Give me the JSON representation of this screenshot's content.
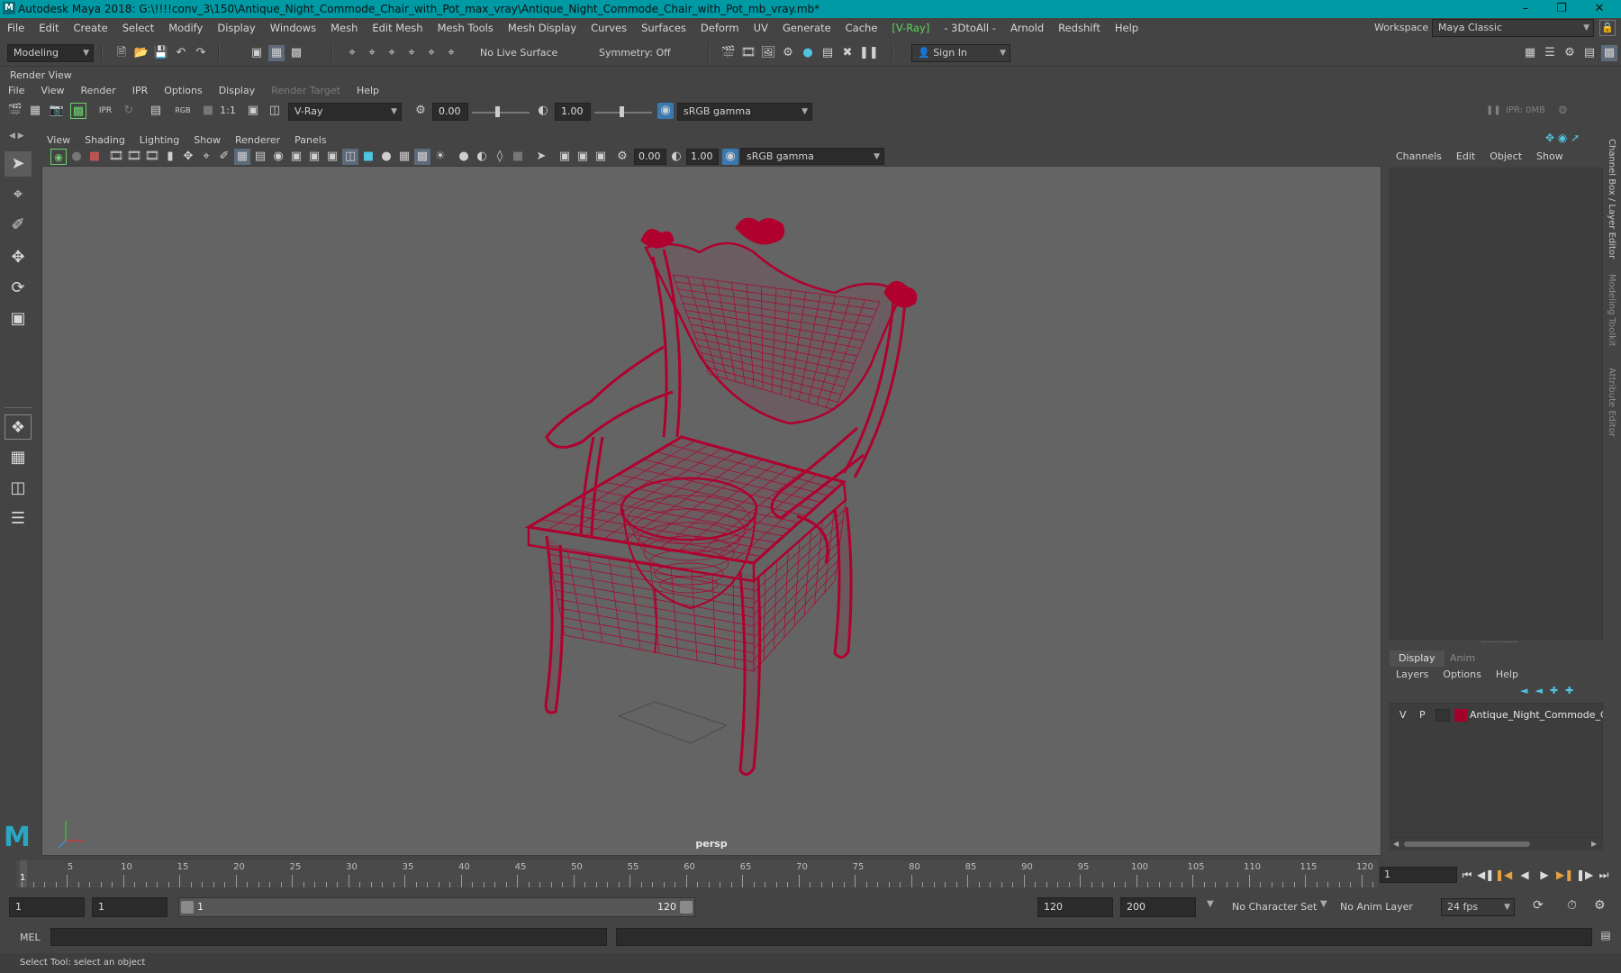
{
  "window": {
    "title": "Autodesk Maya 2018: G:\\!!!!conv_3\\150\\Antique_Night_Commode_Chair_with_Pot_max_vray\\Antique_Night_Commode_Chair_with_Pot_mb_vray.mb*",
    "logo": "M"
  },
  "menubar": {
    "items": [
      "File",
      "Edit",
      "Create",
      "Select",
      "Modify",
      "Display",
      "Windows",
      "Mesh",
      "Edit Mesh",
      "Mesh Tools",
      "Mesh Display",
      "Curves",
      "Surfaces",
      "Deform",
      "UV",
      "Generate",
      "Cache",
      "[V-Ray]",
      "- 3DtoAll -",
      "Arnold",
      "Redshift",
      "Help"
    ],
    "workspace_label": "Workspace :",
    "workspace_value": "Maya Classic"
  },
  "statusline": {
    "menuset": "Modeling",
    "live_surface": "No Live Surface",
    "symmetry": "Symmetry: Off",
    "sign_in": "Sign In"
  },
  "render_view": {
    "title": "Render View",
    "menu": [
      "File",
      "View",
      "Render",
      "IPR",
      "Options",
      "Display",
      "Render Target",
      "Help"
    ],
    "renderer": "V-Ray",
    "exposure": "0.00",
    "gamma": "1.00",
    "color_space": "sRGB gamma",
    "ratio": "1:1",
    "rgb": "RGB",
    "ipr_mem": "IPR: 0MB"
  },
  "panel": {
    "menu": [
      "View",
      "Shading",
      "Lighting",
      "Show",
      "Renderer",
      "Panels"
    ],
    "exposure": "0.00",
    "gamma": "1.00",
    "color_space": "sRGB gamma",
    "camera": "persp",
    "wireframe_color": "#b0002e"
  },
  "channel_box": {
    "menu": [
      "Channels",
      "Edit",
      "Object",
      "Show"
    ]
  },
  "side_tabs": [
    "Channel Box / Layer Editor",
    "Modeling Toolkit",
    "Attribute Editor"
  ],
  "layer_editor": {
    "tabs": [
      "Display",
      "Anim"
    ],
    "menu": [
      "Layers",
      "Options",
      "Help"
    ],
    "layer": {
      "v": "V",
      "p": "P",
      "name": "Antique_Night_Commode_Cha",
      "color": "#a3002c"
    }
  },
  "time_slider": {
    "ticks": [
      5,
      10,
      15,
      20,
      25,
      30,
      35,
      40,
      45,
      50,
      55,
      60,
      65,
      70,
      75,
      80,
      85,
      90,
      95,
      100,
      105,
      110,
      115,
      120
    ],
    "playhead": "1",
    "current_frame": "1"
  },
  "range_slider": {
    "start": "1",
    "playback_start": "1",
    "range_start": "1",
    "range_end": "120",
    "playback_end": "120",
    "end": "200",
    "character_set": "No Character Set",
    "anim_layer": "No Anim Layer",
    "fps": "24 fps"
  },
  "command_line": {
    "label": "MEL"
  },
  "help_line": "Select Tool: select an object"
}
